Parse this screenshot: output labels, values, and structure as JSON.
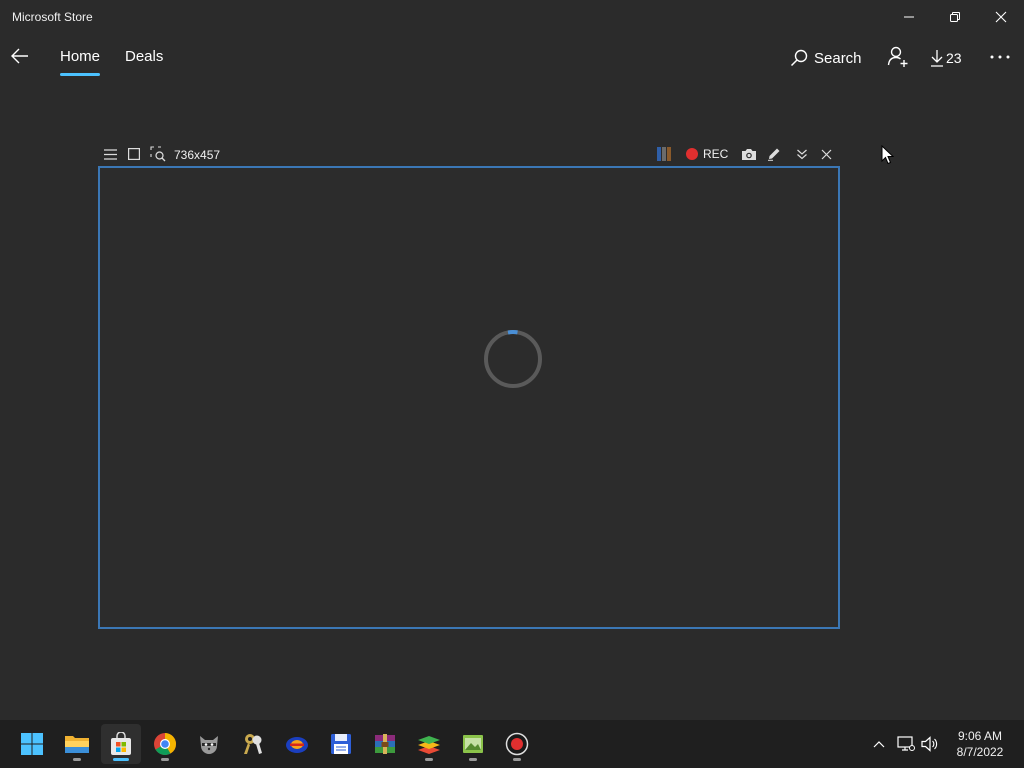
{
  "window": {
    "title": "Microsoft Store"
  },
  "nav": {
    "tabs": [
      {
        "label": "Home",
        "active": true
      },
      {
        "label": "Deals",
        "active": false
      }
    ],
    "search_label": "Search",
    "downloads_count": "23"
  },
  "capture_tool": {
    "size_readout": "736x457",
    "rec_label": "REC",
    "rec_color": "#e02f2f",
    "frame_color": "#3b77b5"
  },
  "colors": {
    "accent": "#4cc2ff",
    "background": "#2b2b2b",
    "taskbar": "#1f1f1f"
  },
  "taskbar": {
    "apps": [
      {
        "name": "start-icon",
        "running": false
      },
      {
        "name": "file-explorer-icon",
        "running": true
      },
      {
        "name": "microsoft-store-icon",
        "running": true,
        "active": true
      },
      {
        "name": "chrome-icon",
        "running": true
      },
      {
        "name": "raccoon-app-icon",
        "running": false
      },
      {
        "name": "keys-app-icon",
        "running": false
      },
      {
        "name": "disc-app-icon",
        "running": false
      },
      {
        "name": "floppy-save-icon",
        "running": false
      },
      {
        "name": "winrar-icon",
        "running": false
      },
      {
        "name": "bluestacks-icon",
        "running": true
      },
      {
        "name": "image-editor-icon",
        "running": true
      },
      {
        "name": "record-icon",
        "running": true
      }
    ],
    "tray_icons": [
      "chevron-up-icon",
      "network-icon",
      "volume-icon"
    ],
    "time": "9:06 AM",
    "date": "8/7/2022"
  }
}
